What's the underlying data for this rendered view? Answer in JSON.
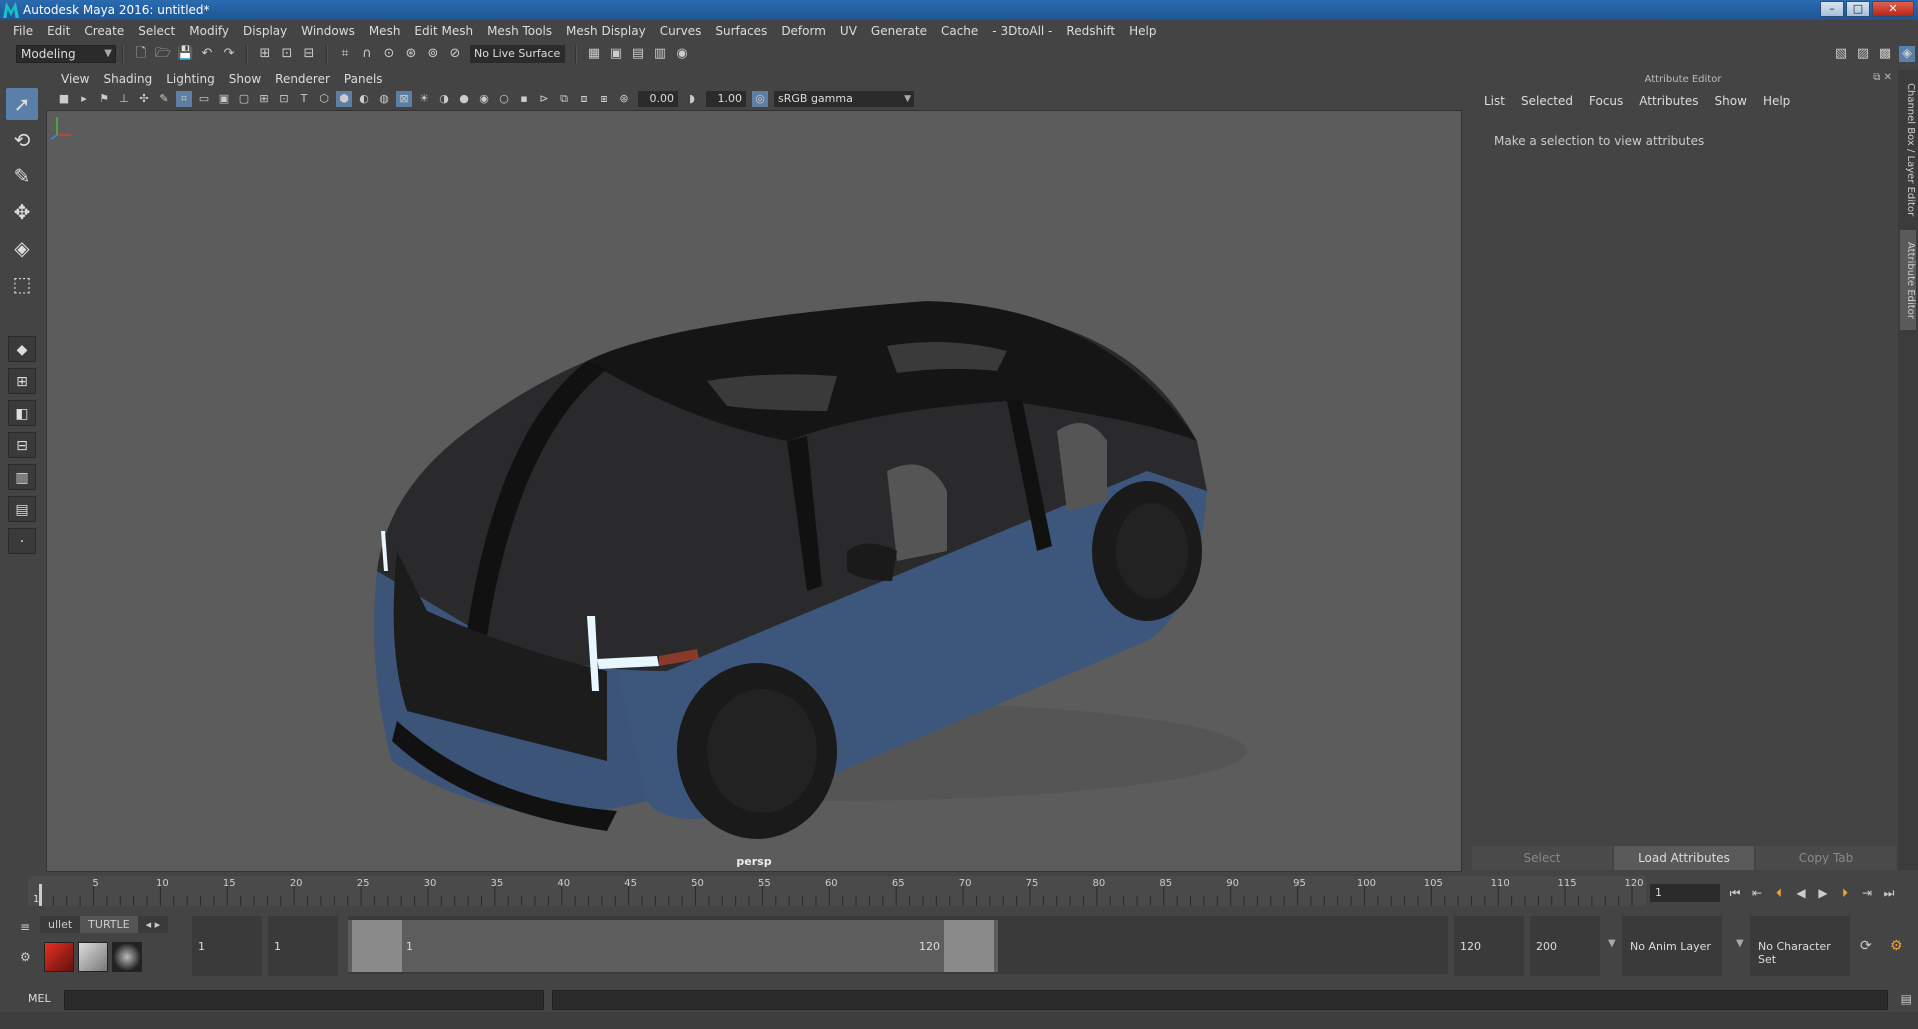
{
  "window": {
    "title": "Autodesk Maya 2016: untitled*",
    "minimize": "–",
    "maximize": "□",
    "close": "✕"
  },
  "menubar": [
    "File",
    "Edit",
    "Create",
    "Select",
    "Modify",
    "Display",
    "Windows",
    "Mesh",
    "Edit Mesh",
    "Mesh Tools",
    "Mesh Display",
    "Curves",
    "Surfaces",
    "Deform",
    "UV",
    "Generate",
    "Cache",
    "- 3DtoAll -",
    "Redshift",
    "Help"
  ],
  "statusline": {
    "mode": "Modeling",
    "live_surface": "No Live Surface"
  },
  "viewport_panel": {
    "menu": [
      "View",
      "Shading",
      "Lighting",
      "Show",
      "Renderer",
      "Panels"
    ],
    "exposure": "0.00",
    "gamma": "1.00",
    "color_space": "sRGB gamma",
    "camera_label": "persp"
  },
  "attribute_editor": {
    "title": "Attribute Editor",
    "menu": [
      "List",
      "Selected",
      "Focus",
      "Attributes",
      "Show",
      "Help"
    ],
    "message": "Make a selection to view attributes",
    "buttons": [
      "Select",
      "Load Attributes",
      "Copy Tab"
    ],
    "side_tabs": [
      "Channel Box / Layer Editor",
      "Attribute Editor"
    ]
  },
  "timeslider": {
    "ticks": [
      "5",
      "10",
      "15",
      "20",
      "25",
      "30",
      "35",
      "40",
      "45",
      "50",
      "55",
      "60",
      "65",
      "70",
      "75",
      "80",
      "85",
      "90",
      "95",
      "100",
      "105",
      "110",
      "115",
      "120"
    ],
    "current_frame_marker": "1",
    "current_frame": "1",
    "current_position": 0,
    "playback_buttons": [
      "⏮",
      "⏭",
      "⇤",
      "◀",
      "▶",
      "⇥",
      "⏭",
      "⏭"
    ]
  },
  "range": {
    "shelf_tabs": [
      "ullet",
      "TURTLE"
    ],
    "start_time": "1",
    "playback_start": "1",
    "handle_start": "1",
    "handle_end": "120",
    "playback_end": "120",
    "end_time": "200",
    "anim_layer": "No Anim Layer",
    "character_set": "No Character Set"
  },
  "cmdline": {
    "language": "MEL"
  },
  "colors": {
    "viewport_bg": "#5c5c5c",
    "panel_bg": "#444444",
    "accent": "#5a7fa8",
    "car_body": "#3b5478"
  }
}
